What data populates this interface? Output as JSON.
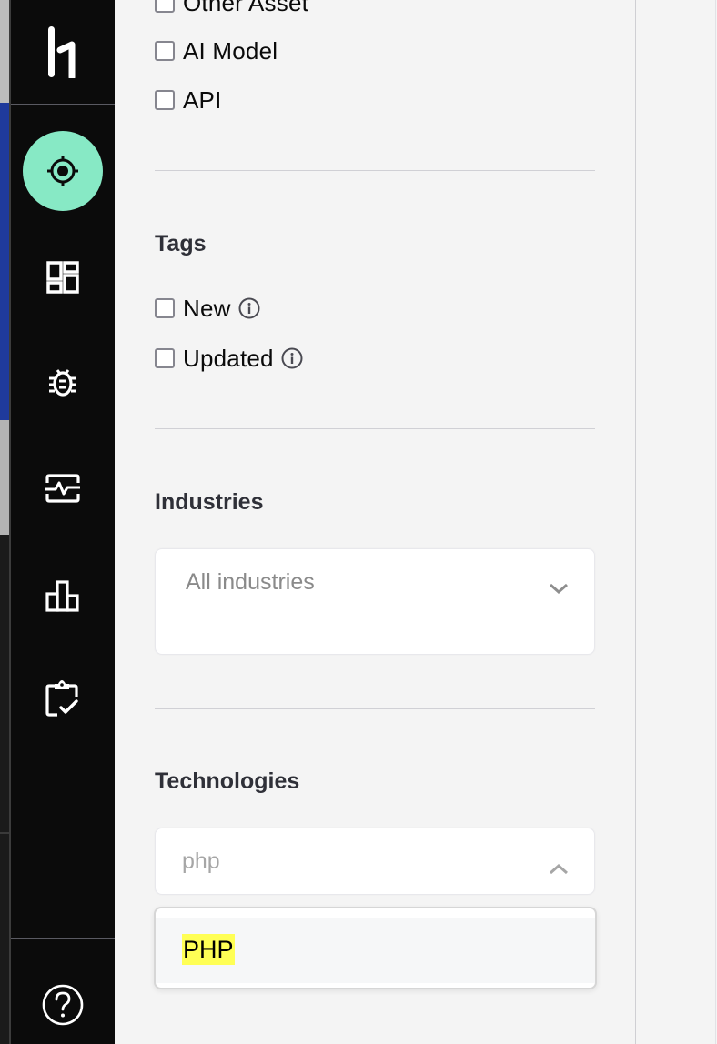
{
  "colors": {
    "sidebar_bg": "#0b0b0b",
    "active_nav_bg": "#87e9c5",
    "panel_bg": "#f4f4f4",
    "highlight": "#ffff55",
    "heading_text": "#2f3038",
    "placeholder_text": "#8a8a8a"
  },
  "sidebar": {
    "logo": "hackerone-logo",
    "items": [
      {
        "name": "targets",
        "icon": "crosshair-icon",
        "active": true
      },
      {
        "name": "dashboard",
        "icon": "dashboard-icon",
        "active": false
      },
      {
        "name": "vulnerabilities",
        "icon": "bug-icon",
        "active": false
      },
      {
        "name": "activity",
        "icon": "activity-monitor-icon",
        "active": false
      },
      {
        "name": "analytics",
        "icon": "bar-chart-icon",
        "active": false
      },
      {
        "name": "tasks",
        "icon": "clipboard-check-icon",
        "active": false
      }
    ],
    "help": {
      "icon": "help-circle-icon"
    }
  },
  "filters": {
    "asset_types": [
      {
        "label": "Other Asset",
        "checked": false
      },
      {
        "label": "AI Model",
        "checked": false
      },
      {
        "label": "API",
        "checked": false
      }
    ],
    "tags": {
      "title": "Tags",
      "items": [
        {
          "label": "New",
          "checked": false,
          "info": true
        },
        {
          "label": "Updated",
          "checked": false,
          "info": true
        }
      ]
    },
    "industries": {
      "title": "Industries",
      "value": "All industries"
    },
    "technologies": {
      "title": "Technologies",
      "input_value": "php",
      "expanded": true,
      "options": [
        {
          "label": "PHP",
          "highlighted": true
        }
      ]
    }
  }
}
